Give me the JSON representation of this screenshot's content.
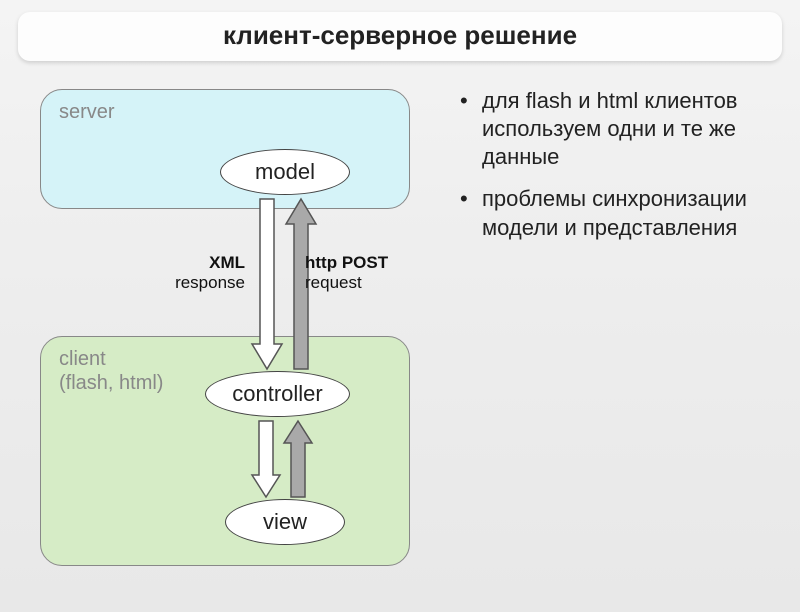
{
  "title": "клиент-серверное решение",
  "diagram": {
    "server_label": "server",
    "client_label": "client\n(flash, html)",
    "nodes": {
      "model": "model",
      "controller": "controller",
      "view": "view"
    },
    "arrows": {
      "xml_label_main": "XML",
      "xml_label_sub": "response",
      "http_label_main": "http POST",
      "http_label_sub": "request"
    }
  },
  "bullets": [
    "для flash и html клиентов используем одни и те же данные",
    "проблемы синхронизации модели и представления"
  ]
}
